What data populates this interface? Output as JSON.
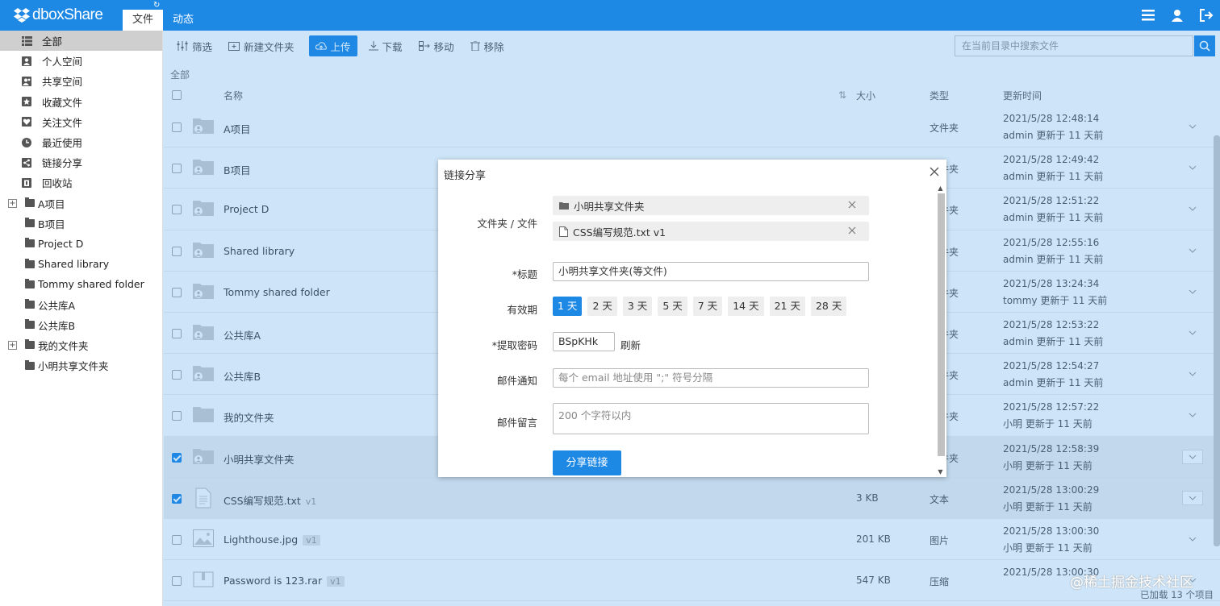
{
  "app": {
    "logo_a": "dbox",
    "logo_b": "Share"
  },
  "tabs": [
    {
      "label": "文件"
    },
    {
      "label": "动态"
    }
  ],
  "sidebar": {
    "items": [
      {
        "label": "全部",
        "icon": "list-icon"
      },
      {
        "label": "个人空间",
        "icon": "user-icon"
      },
      {
        "label": "共享空间",
        "icon": "shared-user-icon"
      },
      {
        "label": "收藏文件",
        "icon": "star-icon"
      },
      {
        "label": "关注文件",
        "icon": "heart-icon"
      },
      {
        "label": "最近使用",
        "icon": "clock-icon"
      },
      {
        "label": "链接分享",
        "icon": "share-icon"
      },
      {
        "label": "回收站",
        "icon": "trash-icon"
      }
    ],
    "folders": [
      {
        "label": "A项目",
        "expandable": true
      },
      {
        "label": "B项目",
        "expandable": false
      },
      {
        "label": "Project D",
        "expandable": false
      },
      {
        "label": "Shared library",
        "expandable": false
      },
      {
        "label": "Tommy shared folder",
        "expandable": false
      },
      {
        "label": "公共库A",
        "expandable": false
      },
      {
        "label": "公共库B",
        "expandable": false
      },
      {
        "label": "我的文件夹",
        "expandable": true
      },
      {
        "label": "小明共享文件夹",
        "expandable": false
      }
    ]
  },
  "toolbar": {
    "filter": "筛选",
    "new_folder": "新建文件夹",
    "upload": "上传",
    "download": "下载",
    "move": "移动",
    "remove": "移除",
    "search_placeholder": "在当前目录中搜索文件"
  },
  "breadcrumb": "全部",
  "table": {
    "headers": {
      "name": "名称",
      "size": "大小",
      "type": "类型",
      "updated": "更新时间"
    },
    "rows": [
      {
        "name": "A项目",
        "version": "",
        "size": "",
        "type": "文件夹",
        "time": "2021/5/28 12:48:14",
        "by": "admin 更新于 11 天前",
        "icon": "shared-folder",
        "selected": false
      },
      {
        "name": "B项目",
        "version": "",
        "size": "",
        "type": "文件夹",
        "time": "2021/5/28 12:49:42",
        "by": "admin 更新于 11 天前",
        "icon": "shared-folder",
        "selected": false
      },
      {
        "name": "Project D",
        "version": "",
        "size": "",
        "type": "文件夹",
        "time": "2021/5/28 12:51:22",
        "by": "admin 更新于 11 天前",
        "icon": "shared-folder",
        "selected": false
      },
      {
        "name": "Shared library",
        "version": "",
        "size": "",
        "type": "文件夹",
        "time": "2021/5/28 12:55:16",
        "by": "admin 更新于 11 天前",
        "icon": "shared-folder",
        "selected": false
      },
      {
        "name": "Tommy shared folder",
        "version": "",
        "size": "",
        "type": "文件夹",
        "time": "2021/5/28 13:24:34",
        "by": "tommy 更新于 11 天前",
        "icon": "shared-folder",
        "selected": false
      },
      {
        "name": "公共库A",
        "version": "",
        "size": "",
        "type": "文件夹",
        "time": "2021/5/28 12:53:22",
        "by": "admin 更新于 11 天前",
        "icon": "shared-folder",
        "selected": false
      },
      {
        "name": "公共库B",
        "version": "",
        "size": "",
        "type": "文件夹",
        "time": "2021/5/28 12:54:27",
        "by": "admin 更新于 11 天前",
        "icon": "shared-folder",
        "selected": false
      },
      {
        "name": "我的文件夹",
        "version": "",
        "size": "",
        "type": "文件夹",
        "time": "2021/5/28 12:57:22",
        "by": "小明 更新于 11 天前",
        "icon": "folder",
        "selected": false
      },
      {
        "name": "小明共享文件夹",
        "version": "",
        "size": "",
        "type": "文件夹",
        "time": "2021/5/28 12:58:39",
        "by": "小明 更新于 11 天前",
        "icon": "shared-folder",
        "selected": true
      },
      {
        "name": "CSS编写规范.txt",
        "version": "v1",
        "size": "3 KB",
        "type": "文本",
        "time": "2021/5/28 13:00:29",
        "by": "小明 更新于 11 天前",
        "icon": "text-file",
        "selected": true
      },
      {
        "name": "Lighthouse.jpg",
        "version": "v1",
        "size": "201 KB",
        "type": "图片",
        "time": "2021/5/28 13:00:30",
        "by": "小明 更新于 11 天前",
        "icon": "image-file",
        "selected": false
      },
      {
        "name": "Password is 123.rar",
        "version": "v1",
        "size": "547 KB",
        "type": "压缩",
        "time": "2021/5/28 13:00:30",
        "by": "",
        "icon": "archive-file",
        "selected": false
      }
    ]
  },
  "footer": "已加载 13 个项目",
  "watermark": "@稀土掘金技术社区",
  "modal": {
    "title": "链接分享",
    "labels": {
      "items": "文件夹 / 文件",
      "title": "*标题",
      "validity": "有效期",
      "password": "*提取密码",
      "email": "邮件通知",
      "message": "邮件留言"
    },
    "items": [
      {
        "name": "小明共享文件夹",
        "kind": "folder"
      },
      {
        "name": "CSS编写规范.txt  v1",
        "kind": "file"
      }
    ],
    "title_value": "小明共享文件夹(等文件)",
    "days": [
      "1 天",
      "2 天",
      "3 天",
      "5 天",
      "7 天",
      "14 天",
      "21 天",
      "28 天"
    ],
    "days_selected": 0,
    "password": "BSpKHk",
    "refresh": "刷新",
    "email_placeholder": "每个 email 地址使用 \";\" 符号分隔",
    "message_placeholder": "200 个字符以内",
    "submit": "分享链接"
  },
  "colors": {
    "accent": "#1e88e5"
  }
}
